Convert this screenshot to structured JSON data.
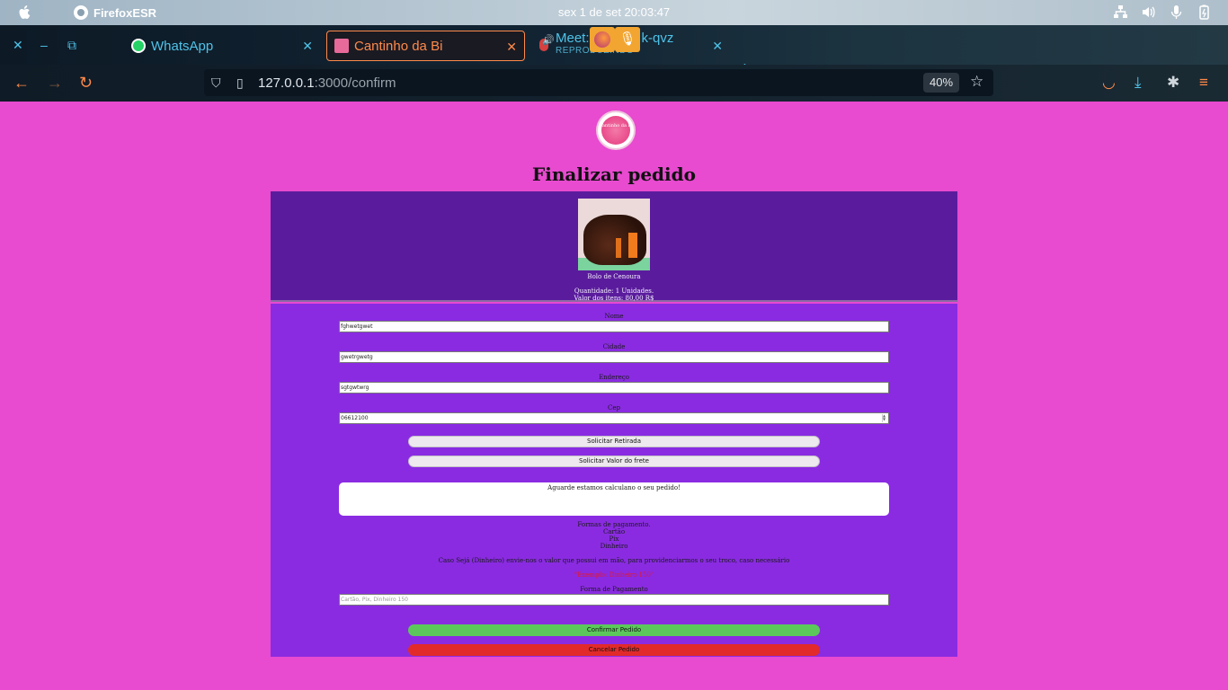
{
  "os": {
    "app_name": "FirefoxESR",
    "clock": "sex 1 de set  20:03:47",
    "tray_icons": [
      "network-icon",
      "volume-icon",
      "microphone-icon",
      "battery-icon"
    ]
  },
  "browser": {
    "tabs": [
      {
        "label": "WhatsApp",
        "icon": "whatsapp-icon"
      },
      {
        "label": "Cantinho da Bi",
        "icon": "site-favicon",
        "active": true
      },
      {
        "label": "Meet:",
        "label_suffix": "k-qvz",
        "subtitle": "REPRODUZINDO",
        "icon": "microphone-icon"
      }
    ],
    "new_tab": "+",
    "url_host": "127.0.0.1",
    "url_path": ":3000/confirm",
    "zoom": "40%",
    "accent_color": "#ff8a4a"
  },
  "page": {
    "logo_text": "Cantinho da Bi",
    "title": "Finalizar pedido",
    "product": {
      "name": "Bolo de Cenoura",
      "quantity": "Quantidade: 1 Unidades.",
      "value": "Valor dos itens: 80,00 R$"
    },
    "form": {
      "nome_label": "Nome",
      "nome_value": "fghwetgwet",
      "cidade_label": "Cidade",
      "cidade_value": "gwetrgwetg",
      "endereco_label": "Endereço",
      "endereco_value": "sgtgwtwrg",
      "cep_label": "Cep",
      "cep_value": "06612100",
      "retirada_button": "Solicitar Retirada",
      "frete_button": "Solicitar Valor do frete",
      "wait_message": "Aguarde estamos calculano o seu pedido!",
      "payment_heading": "Formas de pagamento.",
      "payment_options": [
        "Cartão",
        "Pix",
        "Dinheiro"
      ],
      "cash_note": "Caso Sejá (Dinheiro) envie-nos o valor que possui em mão, para providenciarmos o seu troco, caso necessário",
      "cash_example": "\"Exemplo: Dinheiro 150\"",
      "payment_label": "Forma de Pagamento",
      "payment_placeholder": "Cartão, Pix, Dinheiro 150",
      "confirm_button": "Confirmar Pedido",
      "cancel_button": "Cancelar Pedido"
    },
    "colors": {
      "background": "#e84ad0",
      "product_card": "#5a1c9d",
      "form_panel": "#8a2be2",
      "confirm": "#5cc85c",
      "cancel": "#e22a2a",
      "warning_text": "#e0192e"
    }
  }
}
